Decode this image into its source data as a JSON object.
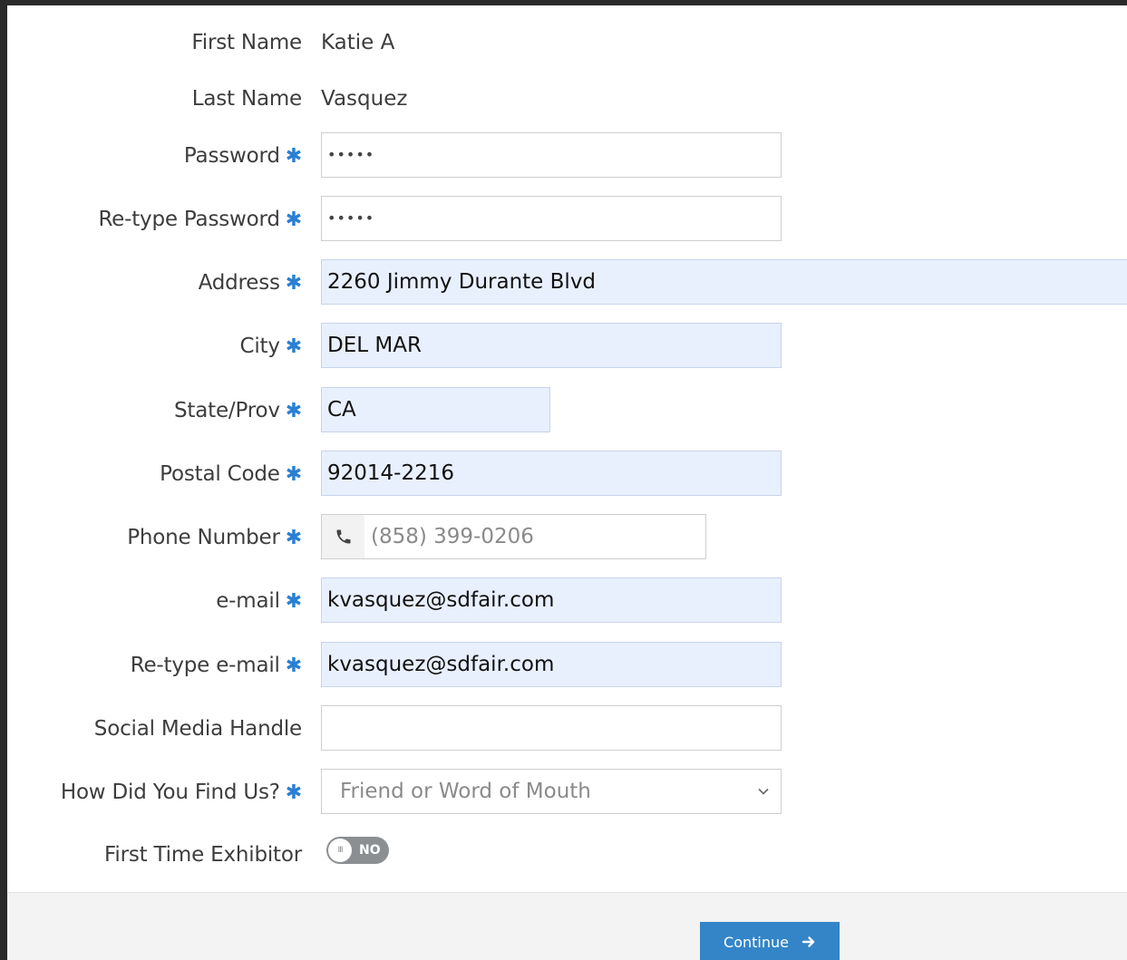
{
  "form": {
    "first_name": {
      "label": "First Name",
      "value": "Katie A"
    },
    "last_name": {
      "label": "Last Name",
      "value": "Vasquez"
    },
    "password": {
      "label": "Password",
      "value": "•••••"
    },
    "retype_password": {
      "label": "Re-type Password",
      "value": "•••••"
    },
    "address": {
      "label": "Address",
      "value": "2260 Jimmy Durante Blvd"
    },
    "city": {
      "label": "City",
      "value": "DEL MAR"
    },
    "state": {
      "label": "State/Prov",
      "value": "CA"
    },
    "postal": {
      "label": "Postal Code",
      "value": "92014-2216"
    },
    "phone": {
      "label": "Phone Number",
      "placeholder": "(858) 399-0206",
      "icon": "phone-icon"
    },
    "email": {
      "label": "e-mail",
      "value": "kvasquez@sdfair.com"
    },
    "retype_email": {
      "label": "Re-type e-mail",
      "value": "kvasquez@sdfair.com"
    },
    "social": {
      "label": "Social Media Handle",
      "value": ""
    },
    "find_us": {
      "label": "How Did You Find Us?",
      "selected": "Friend or Word of Mouth"
    },
    "first_time": {
      "label": "First Time Exhibitor",
      "toggle_text": "NO",
      "toggle_knob_text": "III"
    }
  },
  "required_marker": "✱",
  "footer": {
    "continue_label": "Continue"
  },
  "colors": {
    "accent": "#3385c8",
    "required": "#2a7fd4",
    "autofill": "#e8f0fe"
  }
}
